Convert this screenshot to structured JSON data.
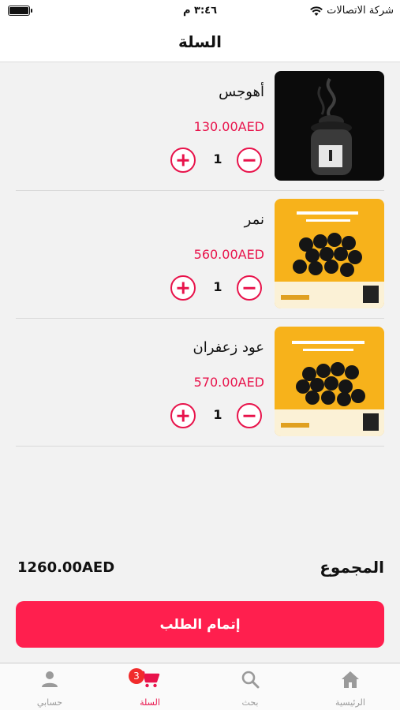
{
  "status_bar": {
    "carrier": "شركة الاتصالات",
    "time": "٣:٤٦ م"
  },
  "header": {
    "title": "السلة"
  },
  "cart": {
    "items": [
      {
        "name": "أهوجس",
        "price": "130.00AED",
        "quantity": "1",
        "image": "black-incense-jar"
      },
      {
        "name": "نمر",
        "price": "560.00AED",
        "quantity": "1",
        "image": "yellow-charcoal-box-nimr"
      },
      {
        "name": "عود زعفران",
        "price": "570.00AED",
        "quantity": "1",
        "image": "yellow-charcoal-box-oud-zafaran"
      }
    ]
  },
  "summary": {
    "total_label": "المجموع",
    "total_value": "1260.00AED"
  },
  "checkout": {
    "label": "إتمام الطلب"
  },
  "tabs": [
    {
      "label": "الرئيسية",
      "icon": "home-icon"
    },
    {
      "label": "بحث",
      "icon": "search-icon"
    },
    {
      "label": "السلة",
      "icon": "cart-icon",
      "badge": "3"
    },
    {
      "label": "حسابي",
      "icon": "person-icon"
    }
  ],
  "colors": {
    "accent": "#e8134b",
    "button": "#ff1f4e",
    "badge": "#f12b2b"
  }
}
